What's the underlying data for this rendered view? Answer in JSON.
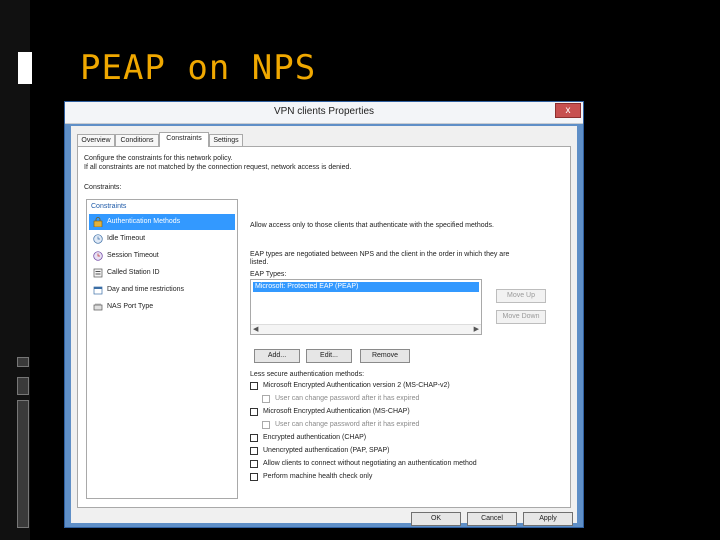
{
  "slide": {
    "title": "PEAP on NPS"
  },
  "dialog": {
    "title": "VPN clients Properties",
    "close_label": "x",
    "tabs": [
      "Overview",
      "Conditions",
      "Constraints",
      "Settings"
    ],
    "description_line1": "Configure the constraints for this network policy.",
    "description_line2": "If all constraints are not matched by the connection request, network access is denied.",
    "constraints_label": "Constraints:",
    "list_header": "Constraints",
    "constraints": [
      {
        "label": "Authentication Methods",
        "icon": "lock-icon"
      },
      {
        "label": "Idle Timeout",
        "icon": "idle-clock-icon"
      },
      {
        "label": "Session Timeout",
        "icon": "session-clock-icon"
      },
      {
        "label": "Called Station ID",
        "icon": "station-icon"
      },
      {
        "label": "Day and time restrictions",
        "icon": "calendar-icon"
      },
      {
        "label": "NAS Port Type",
        "icon": "network-port-icon"
      }
    ],
    "right": {
      "intro": "Allow access only to those clients that authenticate with the specified methods.",
      "eap_note_line1": "EAP types are negotiated between NPS and the client in the order in which they are",
      "eap_note_line2": "listed.",
      "eap_types_label": "EAP Types:",
      "eap_types": [
        "Microsoft: Protected EAP (PEAP)"
      ],
      "move_up": "Move Up",
      "move_down": "Move Down",
      "add": "Add...",
      "edit": "Edit...",
      "remove": "Remove",
      "less_secure_label": "Less secure authentication methods:",
      "options": [
        {
          "label": "Microsoft Encrypted Authentication version 2 (MS-CHAP-v2)",
          "indent": false,
          "enabled": true
        },
        {
          "label": "User can change password after it has expired",
          "indent": true,
          "enabled": false
        },
        {
          "label": "Microsoft Encrypted Authentication (MS-CHAP)",
          "indent": false,
          "enabled": true
        },
        {
          "label": "User can change password after it has expired",
          "indent": true,
          "enabled": false
        },
        {
          "label": "Encrypted authentication (CHAP)",
          "indent": false,
          "enabled": true
        },
        {
          "label": "Unencrypted authentication (PAP, SPAP)",
          "indent": false,
          "enabled": true
        },
        {
          "label": "Allow clients to connect without negotiating an authentication method",
          "indent": false,
          "enabled": true
        },
        {
          "label": "Perform machine health check only",
          "indent": false,
          "enabled": true
        }
      ]
    },
    "footer": {
      "ok": "OK",
      "cancel": "Cancel",
      "apply": "Apply"
    }
  }
}
